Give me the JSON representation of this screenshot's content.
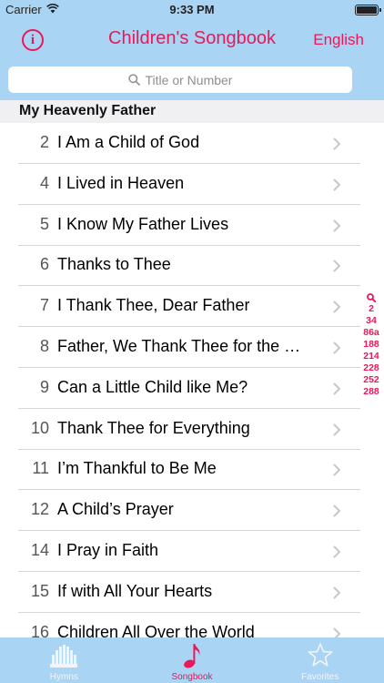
{
  "status_bar": {
    "carrier": "Carrier",
    "time": "9:33 PM"
  },
  "nav": {
    "title": "Children's Songbook",
    "language_button": "English",
    "info_icon": "info-icon"
  },
  "search": {
    "placeholder": "Title or Number"
  },
  "section": {
    "title": "My Heavenly Father"
  },
  "songs": [
    {
      "number": "2",
      "title": "I Am a Child of God"
    },
    {
      "number": "4",
      "title": "I Lived in Heaven"
    },
    {
      "number": "5",
      "title": "I Know My Father Lives"
    },
    {
      "number": "6",
      "title": "Thanks to Thee"
    },
    {
      "number": "7",
      "title": "I Thank Thee, Dear Father"
    },
    {
      "number": "8",
      "title": "Father, We Thank Thee for the Night"
    },
    {
      "number": "9",
      "title": "Can a Little Child like Me?"
    },
    {
      "number": "10",
      "title": "Thank Thee for Everything"
    },
    {
      "number": "11",
      "title": "I’m Thankful to Be Me"
    },
    {
      "number": "12",
      "title": "A Child’s Prayer"
    },
    {
      "number": "14",
      "title": "I Pray in Faith"
    },
    {
      "number": "15",
      "title": "If with All Your Hearts"
    },
    {
      "number": "16",
      "title": "Children All Over the World"
    }
  ],
  "section_index": [
    "2",
    "34",
    "86a",
    "188",
    "214",
    "228",
    "252",
    "288"
  ],
  "tabs": [
    {
      "label": "Hymns",
      "icon": "organ-icon",
      "active": false
    },
    {
      "label": "Songbook",
      "icon": "music-note-icon",
      "active": true
    },
    {
      "label": "Favorites",
      "icon": "star-icon",
      "active": false
    }
  ],
  "colors": {
    "accent": "#e8195b",
    "bar_background": "#a9d4f3",
    "tab_inactive": "#f4f4f6"
  }
}
